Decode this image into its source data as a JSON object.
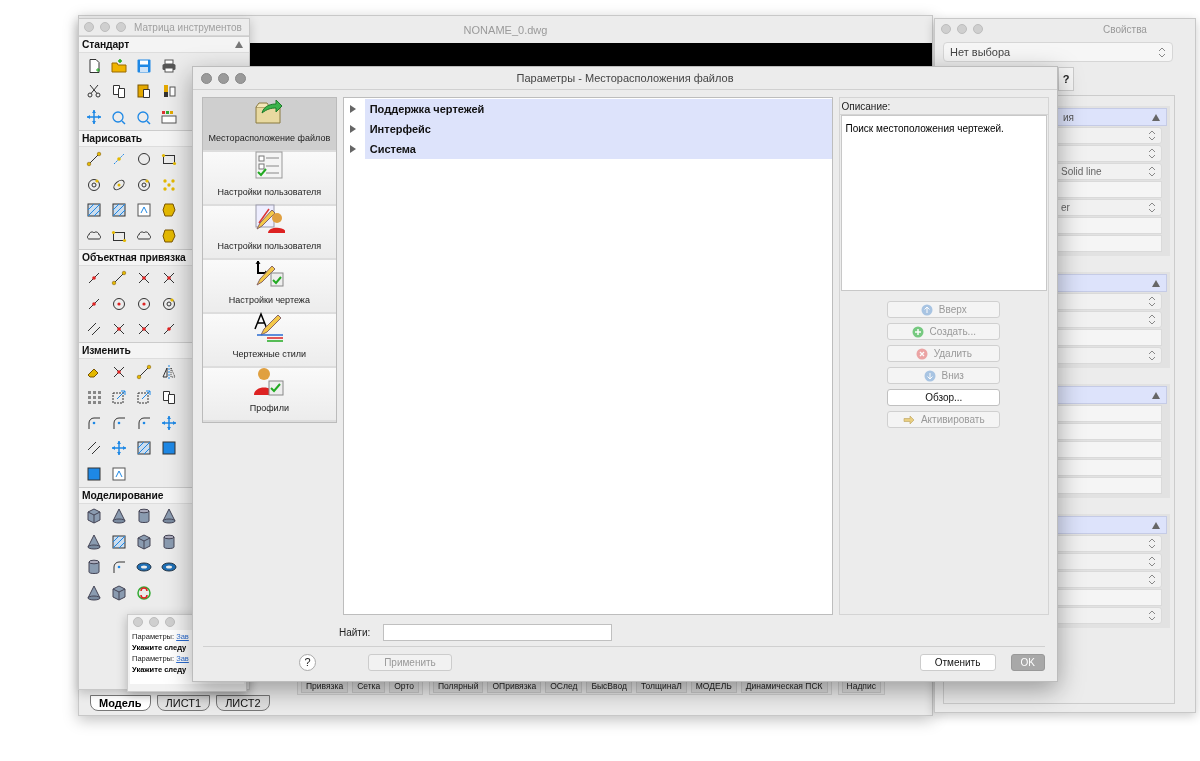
{
  "main_window": {
    "title": "NONAME_0.dwg",
    "status_groups": [
      {
        "buttons": [
          "Привязка",
          "Сетка",
          "Орто"
        ]
      },
      {
        "buttons": [
          "Полярный",
          "ОПривязка",
          "ОСлед",
          "БысВвод",
          "ТолщинаЛ",
          "МОДЕЛЬ",
          "Динамическая ПСК"
        ]
      },
      {
        "buttons": [
          "Надпис"
        ]
      }
    ],
    "layout_tabs": [
      {
        "label": "Модель",
        "selected": true
      },
      {
        "label": "ЛИСТ1",
        "selected": false
      },
      {
        "label": "ЛИСТ2",
        "selected": false
      }
    ]
  },
  "tool_palette": {
    "title": "Матрица инструментов",
    "sections": [
      {
        "title": "Стандарт"
      },
      {
        "title": "Нарисовать"
      },
      {
        "title": "Объектная привязка"
      },
      {
        "title": "Изменить"
      },
      {
        "title": "Моделирование"
      }
    ]
  },
  "command_window": {
    "lines": [
      {
        "kind": "param",
        "text": "Параметры: ",
        "link": "Зав"
      },
      {
        "kind": "prompt",
        "text": "Укажите следу"
      },
      {
        "kind": "param",
        "text": "Параметры: ",
        "link": "Зав"
      },
      {
        "kind": "prompt",
        "text": "Укажите следу"
      }
    ]
  },
  "properties": {
    "title": "Свойства",
    "selection": "Нет выбора",
    "help_button": "?",
    "sections": [
      {
        "title": "ия",
        "rows": [
          {
            "kind": "dropdown"
          },
          {
            "kind": "dropdown"
          },
          {
            "kind": "dropdown",
            "value": "Solid line"
          },
          {
            "kind": "field"
          },
          {
            "kind": "dropdown",
            "value": "er"
          },
          {
            "kind": "field"
          },
          {
            "kind": "field"
          }
        ]
      },
      {
        "rows": [
          {
            "kind": "dropdown"
          },
          {
            "kind": "dropdown"
          },
          {
            "kind": "field"
          },
          {
            "kind": "dropdown"
          }
        ]
      },
      {
        "rows": [
          {
            "kind": "field"
          },
          {
            "kind": "field"
          },
          {
            "kind": "field"
          },
          {
            "kind": "field"
          },
          {
            "kind": "field"
          }
        ]
      },
      {
        "rows": [
          {
            "kind": "dropdown"
          },
          {
            "kind": "dropdown"
          },
          {
            "kind": "dropdown"
          },
          {
            "kind": "field"
          },
          {
            "kind": "dropdown"
          }
        ]
      }
    ]
  },
  "dialog": {
    "title": "Параметры - Месторасположения файлов",
    "nav": [
      {
        "label": "Месторасположение файлов",
        "selected": true
      },
      {
        "label": "Настройки пользователя",
        "selected": false
      },
      {
        "label": "Настройки пользователя",
        "selected": false
      },
      {
        "label": "Настройки чертежа",
        "selected": false
      },
      {
        "label": "Чертежные стили",
        "selected": false
      },
      {
        "label": "Профили",
        "selected": false
      }
    ],
    "tree": [
      {
        "label": "Поддержка чертежей",
        "expanded": false
      },
      {
        "label": "Интерфейс",
        "expanded": false
      },
      {
        "label": "Система",
        "expanded": false
      }
    ],
    "description_label": "Описание:",
    "description": "Поиск местоположения чертежей.",
    "side_buttons": [
      {
        "kind": "up",
        "label": "Вверх",
        "disabled": true
      },
      {
        "kind": "add",
        "label": "Создать...",
        "disabled": true
      },
      {
        "kind": "remove",
        "label": "Удалить",
        "disabled": true
      },
      {
        "kind": "down",
        "label": "Вниз",
        "disabled": true
      },
      {
        "kind": "plain",
        "label": "Обзор...",
        "disabled": false
      },
      {
        "kind": "activate",
        "label": "Активировать",
        "disabled": true
      }
    ],
    "search_label": "Найти:",
    "help": "?",
    "apply_button": {
      "label": "Применить",
      "disabled": true
    },
    "cancel_button": {
      "label": "Отменить",
      "disabled": false
    },
    "ok_button": {
      "label": "OK",
      "disabled": true
    }
  }
}
